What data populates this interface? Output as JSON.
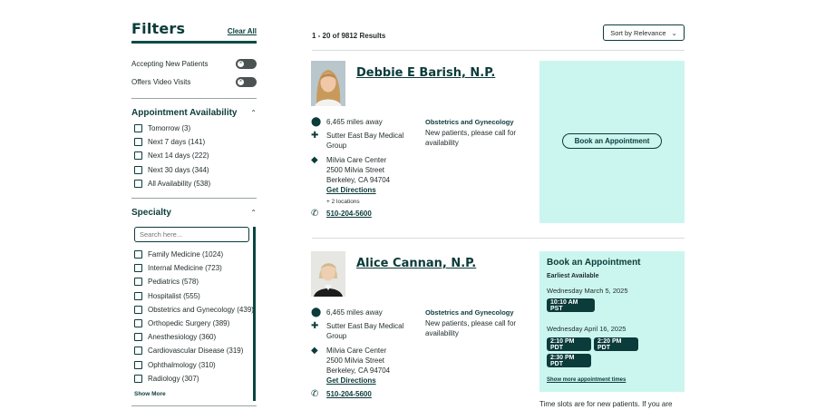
{
  "sidebar": {
    "title": "Filters",
    "clear_all": "Clear All",
    "toggles": [
      {
        "label": "Accepting New Patients",
        "on": false
      },
      {
        "label": "Offers Video Visits",
        "on": false
      }
    ],
    "availability": {
      "title": "Appointment Availability",
      "options": [
        "Tomorrow (3)",
        "Next 7 days (141)",
        "Next 14 days (222)",
        "Next 30 days (344)",
        "All Availability (538)"
      ]
    },
    "specialty": {
      "title": "Specialty",
      "search_placeholder": "Search here...",
      "options": [
        "Family Medicine (1024)",
        "Internal Medicine (723)",
        "Pediatrics (578)",
        "Hospitalist (555)",
        "Obstetrics and Gynecology (439)",
        "Orthopedic Surgery (389)",
        "Anesthesiology (360)",
        "Cardiovascular Disease (319)",
        "Ophthalmology (310)",
        "Radiology (307)"
      ],
      "show_more": "Show More"
    }
  },
  "results": {
    "count": "1 - 20 of 9812 Results",
    "sort_label": "Sort by Relevance"
  },
  "providers": [
    {
      "name": "Debbie E Barish, N.P.",
      "distance": "6,465 miles away",
      "group": "Sutter East Bay Medical Group",
      "facility": "Milvia Care Center",
      "street": "2500 Milvia Street",
      "city": "Berkeley, CA 94704",
      "directions": "Get Directions",
      "more_locations": "+ 2 locations",
      "phone": "510-204-5600",
      "specialty": "Obstetrics and Gynecology",
      "availability_note": "New patients, please call for availability",
      "book_button": "Book an Appointment"
    },
    {
      "name": "Alice Cannan, N.P.",
      "distance": "6,465 miles away",
      "group": "Sutter East Bay Medical Group",
      "facility": "Milvia Care Center",
      "street": "2500 Milvia Street",
      "city": "Berkeley, CA 94704",
      "directions": "Get Directions",
      "phone": "510-204-5600",
      "specialty": "Obstetrics and Gynecology",
      "availability_note": "New patients, please call for availability",
      "booking": {
        "title": "Book an Appointment",
        "earliest": "Earliest Available",
        "date1": "Wednesday March 5, 2025",
        "date1_slots": [
          "10:10 AM PST"
        ],
        "date2": "Wednesday April 16, 2025",
        "date2_slots": [
          "2:10 PM PDT",
          "2:20 PM PDT",
          "2:30 PM PDT"
        ],
        "show_more": "Show more appointment times",
        "note": "Time slots are for new patients. If you are"
      }
    }
  ],
  "colors": {
    "brand_dark": "#0b3b3a",
    "booking_bg": "#cbf6ef"
  }
}
